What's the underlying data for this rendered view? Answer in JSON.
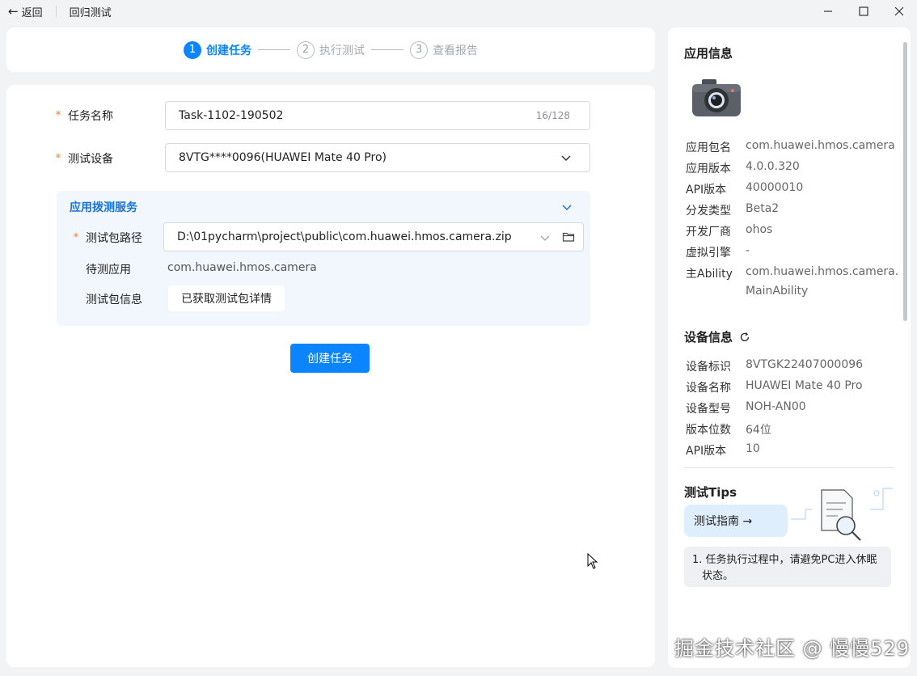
{
  "titlebar": {
    "back_label": "返回",
    "title": "回归测试"
  },
  "stepper": {
    "steps": [
      {
        "num": "1",
        "label": "创建任务",
        "active": true
      },
      {
        "num": "2",
        "label": "执行测试",
        "active": false
      },
      {
        "num": "3",
        "label": "查看报告",
        "active": false
      }
    ]
  },
  "form": {
    "task_name_label": "任务名称",
    "task_name_value": "Task-1102-190502",
    "task_name_counter": "16/128",
    "device_label": "测试设备",
    "device_value": "8VTG****0096(HUAWEI Mate 40 Pro)",
    "required_mark": "*",
    "service": {
      "title": "应用拨测服务",
      "pkg_path_label": "测试包路径",
      "pkg_path_value": "D:\\01pycharm\\project\\public\\com.huawei.hmos.camera.zip",
      "app_label": "待测应用",
      "app_value": "com.huawei.hmos.camera",
      "pkg_info_label": "测试包信息",
      "pkg_info_button": "已获取测试包详情"
    },
    "create_button": "创建任务"
  },
  "app_info": {
    "title": "应用信息",
    "rows": [
      {
        "k": "应用包名",
        "v": "com.huawei.hmos.camera"
      },
      {
        "k": "应用版本",
        "v": "4.0.0.320"
      },
      {
        "k": "API版本",
        "v": "40000010"
      },
      {
        "k": "分发类型",
        "v": "Beta2"
      },
      {
        "k": "开发厂商",
        "v": "ohos"
      },
      {
        "k": "虚拟引擎",
        "v": "-"
      },
      {
        "k": "主Ability",
        "v": "com.huawei.hmos.camera."
      },
      {
        "k": "",
        "v": "MainAbility"
      }
    ]
  },
  "device_info": {
    "title": "设备信息",
    "rows": [
      {
        "k": "设备标识",
        "v": "8VTGK22407000096"
      },
      {
        "k": "设备名称",
        "v": "HUAWEI Mate 40 Pro"
      },
      {
        "k": "设备型号",
        "v": "NOH-AN00"
      },
      {
        "k": "版本位数",
        "v": "64位"
      },
      {
        "k": "API版本",
        "v": "10"
      }
    ]
  },
  "tips": {
    "title": "测试Tips",
    "guide_button": "测试指南 →",
    "tip_line1": "1. 任务执行过程中，请避免PC进入休眠",
    "tip_line2": "状态。"
  },
  "watermark": "掘金技术社区 @ 慢慢529",
  "colors": {
    "accent": "#0a84ff",
    "required": "#e08a3c",
    "service_title": "#1a73d9"
  }
}
